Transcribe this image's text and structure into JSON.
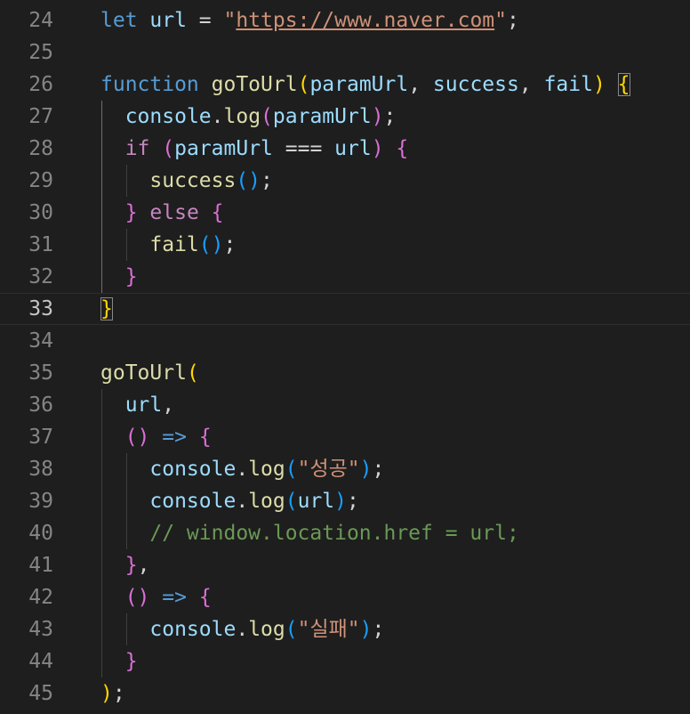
{
  "editor": {
    "lines": [
      {
        "n": "24",
        "code": [
          {
            "t": "let",
            "c": "kw"
          },
          {
            "t": " ",
            "c": "punc"
          },
          {
            "t": "url",
            "c": "var"
          },
          {
            "t": " = ",
            "c": "punc"
          },
          {
            "t": "\"",
            "c": "str"
          },
          {
            "t": "https://www.naver.com",
            "c": "str url"
          },
          {
            "t": "\"",
            "c": "str"
          },
          {
            "t": ";",
            "c": "punc"
          }
        ]
      },
      {
        "n": "25",
        "code": []
      },
      {
        "n": "26",
        "code": [
          {
            "t": "function",
            "c": "kw"
          },
          {
            "t": " ",
            "c": "punc"
          },
          {
            "t": "goToUrl",
            "c": "fn"
          },
          {
            "t": "(",
            "c": "p1"
          },
          {
            "t": "paramUrl",
            "c": "var"
          },
          {
            "t": ", ",
            "c": "punc"
          },
          {
            "t": "success",
            "c": "var"
          },
          {
            "t": ", ",
            "c": "punc"
          },
          {
            "t": "fail",
            "c": "var"
          },
          {
            "t": ")",
            "c": "p1"
          },
          {
            "t": " ",
            "c": "punc"
          },
          {
            "t": "{",
            "c": "p1 match"
          }
        ]
      },
      {
        "n": "27",
        "code": [
          {
            "t": "  ",
            "c": "punc"
          },
          {
            "t": "console",
            "c": "var"
          },
          {
            "t": ".",
            "c": "punc"
          },
          {
            "t": "log",
            "c": "fn"
          },
          {
            "t": "(",
            "c": "p2"
          },
          {
            "t": "paramUrl",
            "c": "var"
          },
          {
            "t": ")",
            "c": "p2"
          },
          {
            "t": ";",
            "c": "punc"
          }
        ]
      },
      {
        "n": "28",
        "code": [
          {
            "t": "  ",
            "c": "punc"
          },
          {
            "t": "if",
            "c": "ctl"
          },
          {
            "t": " ",
            "c": "punc"
          },
          {
            "t": "(",
            "c": "p2"
          },
          {
            "t": "paramUrl",
            "c": "var"
          },
          {
            "t": " === ",
            "c": "punc"
          },
          {
            "t": "url",
            "c": "var"
          },
          {
            "t": ")",
            "c": "p2"
          },
          {
            "t": " ",
            "c": "punc"
          },
          {
            "t": "{",
            "c": "p2"
          }
        ]
      },
      {
        "n": "29",
        "code": [
          {
            "t": "    ",
            "c": "punc"
          },
          {
            "t": "success",
            "c": "fn"
          },
          {
            "t": "()",
            "c": "p3"
          },
          {
            "t": ";",
            "c": "punc"
          }
        ]
      },
      {
        "n": "30",
        "code": [
          {
            "t": "  ",
            "c": "punc"
          },
          {
            "t": "}",
            "c": "p2"
          },
          {
            "t": " ",
            "c": "punc"
          },
          {
            "t": "else",
            "c": "ctl"
          },
          {
            "t": " ",
            "c": "punc"
          },
          {
            "t": "{",
            "c": "p2"
          }
        ]
      },
      {
        "n": "31",
        "code": [
          {
            "t": "    ",
            "c": "punc"
          },
          {
            "t": "fail",
            "c": "fn"
          },
          {
            "t": "()",
            "c": "p3"
          },
          {
            "t": ";",
            "c": "punc"
          }
        ]
      },
      {
        "n": "32",
        "code": [
          {
            "t": "  ",
            "c": "punc"
          },
          {
            "t": "}",
            "c": "p2"
          }
        ]
      },
      {
        "n": "33",
        "active": true,
        "code": [
          {
            "t": "}",
            "c": "p1 cursor-box"
          }
        ]
      },
      {
        "n": "34",
        "code": []
      },
      {
        "n": "35",
        "code": [
          {
            "t": "goToUrl",
            "c": "fn"
          },
          {
            "t": "(",
            "c": "p1"
          }
        ]
      },
      {
        "n": "36",
        "code": [
          {
            "t": "  ",
            "c": "punc"
          },
          {
            "t": "url",
            "c": "var"
          },
          {
            "t": ",",
            "c": "punc"
          }
        ]
      },
      {
        "n": "37",
        "code": [
          {
            "t": "  ",
            "c": "punc"
          },
          {
            "t": "()",
            "c": "p2"
          },
          {
            "t": " ",
            "c": "punc"
          },
          {
            "t": "=>",
            "c": "kw"
          },
          {
            "t": " ",
            "c": "punc"
          },
          {
            "t": "{",
            "c": "p2"
          }
        ]
      },
      {
        "n": "38",
        "code": [
          {
            "t": "    ",
            "c": "punc"
          },
          {
            "t": "console",
            "c": "var"
          },
          {
            "t": ".",
            "c": "punc"
          },
          {
            "t": "log",
            "c": "fn"
          },
          {
            "t": "(",
            "c": "p3"
          },
          {
            "t": "\"성공\"",
            "c": "str"
          },
          {
            "t": ")",
            "c": "p3"
          },
          {
            "t": ";",
            "c": "punc"
          }
        ]
      },
      {
        "n": "39",
        "code": [
          {
            "t": "    ",
            "c": "punc"
          },
          {
            "t": "console",
            "c": "var"
          },
          {
            "t": ".",
            "c": "punc"
          },
          {
            "t": "log",
            "c": "fn"
          },
          {
            "t": "(",
            "c": "p3"
          },
          {
            "t": "url",
            "c": "var"
          },
          {
            "t": ")",
            "c": "p3"
          },
          {
            "t": ";",
            "c": "punc"
          }
        ]
      },
      {
        "n": "40",
        "code": [
          {
            "t": "    ",
            "c": "punc"
          },
          {
            "t": "// window.location.href = url;",
            "c": "cmt"
          }
        ]
      },
      {
        "n": "41",
        "code": [
          {
            "t": "  ",
            "c": "punc"
          },
          {
            "t": "}",
            "c": "p2"
          },
          {
            "t": ",",
            "c": "punc"
          }
        ]
      },
      {
        "n": "42",
        "code": [
          {
            "t": "  ",
            "c": "punc"
          },
          {
            "t": "()",
            "c": "p2"
          },
          {
            "t": " ",
            "c": "punc"
          },
          {
            "t": "=>",
            "c": "kw"
          },
          {
            "t": " ",
            "c": "punc"
          },
          {
            "t": "{",
            "c": "p2"
          }
        ]
      },
      {
        "n": "43",
        "code": [
          {
            "t": "    ",
            "c": "punc"
          },
          {
            "t": "console",
            "c": "var"
          },
          {
            "t": ".",
            "c": "punc"
          },
          {
            "t": "log",
            "c": "fn"
          },
          {
            "t": "(",
            "c": "p3"
          },
          {
            "t": "\"실패\"",
            "c": "str"
          },
          {
            "t": ")",
            "c": "p3"
          },
          {
            "t": ";",
            "c": "punc"
          }
        ]
      },
      {
        "n": "44",
        "code": [
          {
            "t": "  ",
            "c": "punc"
          },
          {
            "t": "}",
            "c": "p2"
          }
        ]
      },
      {
        "n": "45",
        "code": [
          {
            "t": ")",
            "c": "p1"
          },
          {
            "t": ";",
            "c": "punc"
          }
        ]
      }
    ]
  }
}
